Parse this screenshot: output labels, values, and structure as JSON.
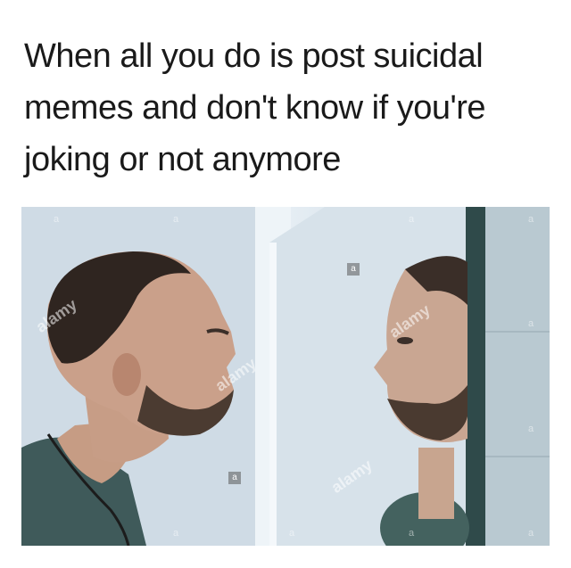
{
  "caption": {
    "line1": "When all you do is post suicidal",
    "line2": "memes and don't know if you're",
    "line3": "joking or not anymore"
  },
  "photo": {
    "watermark": "alamy",
    "watermark_letter": "a"
  }
}
